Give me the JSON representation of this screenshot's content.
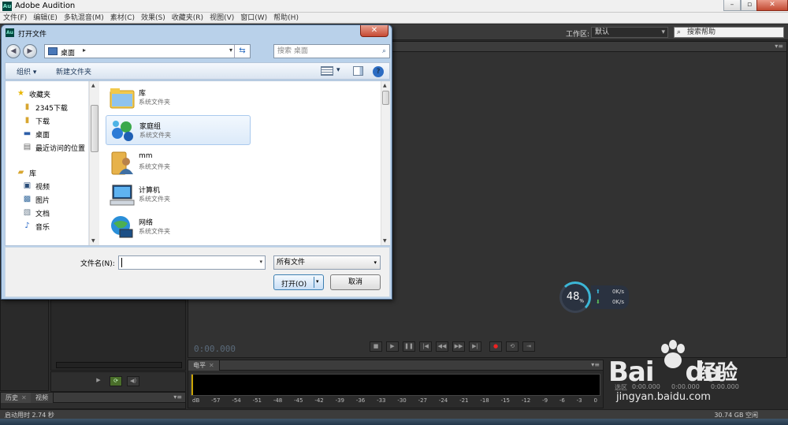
{
  "app": {
    "title": "Adobe Audition",
    "logo": "Au"
  },
  "menu": [
    "文件(F)",
    "编辑(E)",
    "多轨混音(M)",
    "素材(C)",
    "效果(S)",
    "收藏夹(R)",
    "视图(V)",
    "窗口(W)",
    "帮助(H)"
  ],
  "workspace": {
    "label": "工作区:",
    "value": "默认",
    "search_placeholder": "搜索帮助"
  },
  "transport": {
    "time": "0:00.000"
  },
  "panels": {
    "level_tab": "电平",
    "history_tab": "历史",
    "video_tab": "视频",
    "selection_label": "选区",
    "selection_values": [
      "0:00.000",
      "0:00.000",
      "0:00.000"
    ]
  },
  "meter_scale": [
    "dB",
    "-57",
    "-54",
    "-51",
    "-48",
    "-45",
    "-42",
    "-39",
    "-36",
    "-33",
    "-30",
    "-27",
    "-24",
    "-21",
    "-18",
    "-15",
    "-12",
    "-9",
    "-6",
    "-3",
    "0"
  ],
  "status": {
    "startup": "启动用时 2.74 秒",
    "disk": "30.74 GB 空闲"
  },
  "speed_widget": {
    "percent": "48",
    "unit": "%",
    "up": "0K/s",
    "down": "0K/s"
  },
  "watermark": {
    "brand": "Bai",
    "brand2": "du",
    "cn": "经验",
    "url": "jingyan.baidu.com"
  },
  "dialog": {
    "title": "打开文件",
    "path": "桌面",
    "search_placeholder": "搜索 桌面",
    "organize": "组织 ▾",
    "new_folder": "新建文件夹",
    "nav": {
      "favorites": "收藏夹",
      "fav_items": [
        "2345下载",
        "下载",
        "桌面",
        "最近访问的位置"
      ],
      "libraries": "库",
      "lib_items": [
        "视频",
        "图片",
        "文档",
        "音乐"
      ]
    },
    "files": [
      {
        "name": "库",
        "type": "系统文件夹"
      },
      {
        "name": "家庭组",
        "type": "系统文件夹"
      },
      {
        "name": "mm",
        "type": "系统文件夹"
      },
      {
        "name": "计算机",
        "type": "系统文件夹"
      },
      {
        "name": "网络",
        "type": "系统文件夹"
      }
    ],
    "filename_label": "文件名(N):",
    "filename_value": "",
    "filetype": "所有文件",
    "open": "打开(O)",
    "cancel": "取消"
  }
}
